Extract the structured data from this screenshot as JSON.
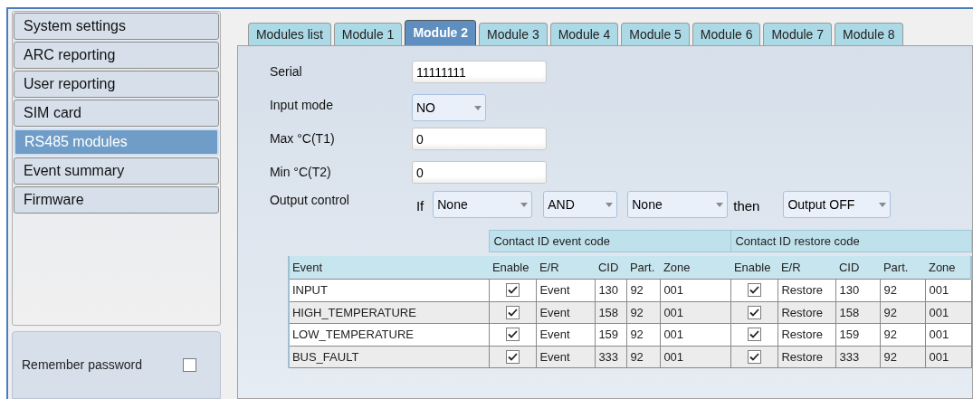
{
  "sidebar": {
    "items": [
      {
        "label": "System settings",
        "selected": false
      },
      {
        "label": "ARC reporting",
        "selected": false
      },
      {
        "label": "User reporting",
        "selected": false
      },
      {
        "label": "SIM card",
        "selected": false
      },
      {
        "label": "RS485 modules",
        "selected": true
      },
      {
        "label": "Event summary",
        "selected": false
      },
      {
        "label": "Firmware",
        "selected": false
      }
    ]
  },
  "remember_password": {
    "label": "Remember password",
    "checked": false
  },
  "tabs": [
    {
      "label": "Modules list",
      "selected": false
    },
    {
      "label": "Module 1",
      "selected": false
    },
    {
      "label": "Module 2",
      "selected": true
    },
    {
      "label": "Module 3",
      "selected": false
    },
    {
      "label": "Module 4",
      "selected": false
    },
    {
      "label": "Module 5",
      "selected": false
    },
    {
      "label": "Module 6",
      "selected": false
    },
    {
      "label": "Module 7",
      "selected": false
    },
    {
      "label": "Module 8",
      "selected": false
    }
  ],
  "form": {
    "fields": [
      {
        "kind": "text",
        "label": "Serial",
        "value": "11111111"
      },
      {
        "kind": "select",
        "label": "Input mode",
        "value": "NO"
      },
      {
        "kind": "text",
        "label": "Max °C(T1)",
        "value": "0"
      },
      {
        "kind": "text",
        "label": "Min °C(T2)",
        "value": "0"
      }
    ],
    "output_control": {
      "label": "Output control",
      "if_label": "If",
      "condition_1": "None",
      "operator": "AND",
      "condition_2": "None",
      "then_label": "then",
      "action": "Output OFF"
    }
  },
  "table": {
    "groups": [
      {
        "label": "Contact ID event code"
      },
      {
        "label": "Contact ID restore code"
      }
    ],
    "columns": [
      "Event",
      "Enable",
      "E/R",
      "CID",
      "Part.",
      "Zone",
      "Enable",
      "E/R",
      "CID",
      "Part.",
      "Zone"
    ],
    "rows": [
      {
        "cells": [
          {
            "kind": "text",
            "text": "INPUT"
          },
          {
            "kind": "check",
            "checked": true
          },
          {
            "kind": "text",
            "text": "Event"
          },
          {
            "kind": "text",
            "text": "130"
          },
          {
            "kind": "text",
            "text": "92"
          },
          {
            "kind": "text",
            "text": "001"
          },
          {
            "kind": "check",
            "checked": true
          },
          {
            "kind": "text",
            "text": "Restore"
          },
          {
            "kind": "text",
            "text": "130"
          },
          {
            "kind": "text",
            "text": "92"
          },
          {
            "kind": "text",
            "text": "001"
          }
        ]
      },
      {
        "cells": [
          {
            "kind": "text",
            "text": "HIGH_TEMPERATURE"
          },
          {
            "kind": "check",
            "checked": true
          },
          {
            "kind": "text",
            "text": "Event"
          },
          {
            "kind": "text",
            "text": "158"
          },
          {
            "kind": "text",
            "text": "92"
          },
          {
            "kind": "text",
            "text": "001"
          },
          {
            "kind": "check",
            "checked": true
          },
          {
            "kind": "text",
            "text": "Restore"
          },
          {
            "kind": "text",
            "text": "158"
          },
          {
            "kind": "text",
            "text": "92"
          },
          {
            "kind": "text",
            "text": "001"
          }
        ]
      },
      {
        "cells": [
          {
            "kind": "text",
            "text": "LOW_TEMPERATURE"
          },
          {
            "kind": "check",
            "checked": true
          },
          {
            "kind": "text",
            "text": "Event"
          },
          {
            "kind": "text",
            "text": "159"
          },
          {
            "kind": "text",
            "text": "92"
          },
          {
            "kind": "text",
            "text": "001"
          },
          {
            "kind": "check",
            "checked": true
          },
          {
            "kind": "text",
            "text": "Restore"
          },
          {
            "kind": "text",
            "text": "159"
          },
          {
            "kind": "text",
            "text": "92"
          },
          {
            "kind": "text",
            "text": "001"
          }
        ]
      },
      {
        "cells": [
          {
            "kind": "text",
            "text": "BUS_FAULT"
          },
          {
            "kind": "check",
            "checked": true
          },
          {
            "kind": "text",
            "text": "Event"
          },
          {
            "kind": "text",
            "text": "333"
          },
          {
            "kind": "text",
            "text": "92"
          },
          {
            "kind": "text",
            "text": "001"
          },
          {
            "kind": "check",
            "checked": true
          },
          {
            "kind": "text",
            "text": "Restore"
          },
          {
            "kind": "text",
            "text": "333"
          },
          {
            "kind": "text",
            "text": "92"
          },
          {
            "kind": "text",
            "text": "001"
          }
        ]
      }
    ]
  }
}
